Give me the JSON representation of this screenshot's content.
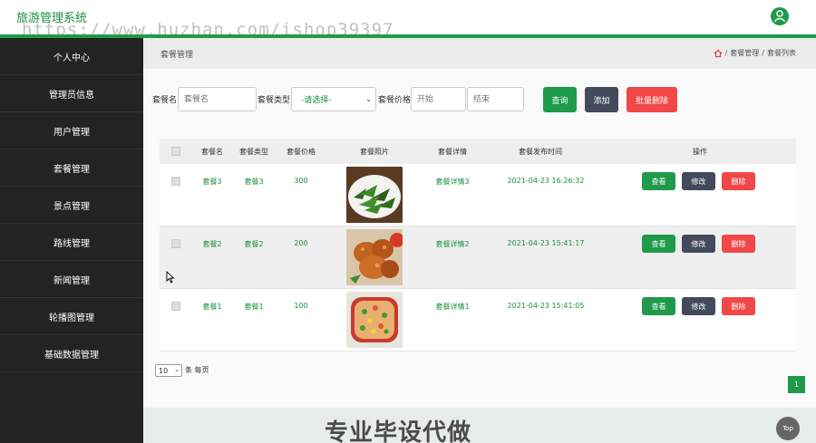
{
  "app": {
    "title": "旅游管理系统",
    "watermark": "https://www.huzhan.com/ishop39397",
    "user_icon": "user-circle-icon"
  },
  "sidebar": {
    "items": [
      {
        "label": "个人中心"
      },
      {
        "label": "管理员信息"
      },
      {
        "label": "用户管理"
      },
      {
        "label": "套餐管理"
      },
      {
        "label": "景点管理"
      },
      {
        "label": "路线管理"
      },
      {
        "label": "新闻管理"
      },
      {
        "label": "轮播图管理"
      },
      {
        "label": "基础数据管理"
      }
    ]
  },
  "header": {
    "page_title": "套餐管理",
    "breadcrumb": [
      "套餐管理",
      "套餐列表"
    ],
    "breadcrumb_sep": "/"
  },
  "search": {
    "name_label": "套餐名",
    "name_placeholder": "套餐名",
    "type_label": "套餐类型",
    "type_selected": "-请选择-",
    "price_label": "套餐价格",
    "price_min_placeholder": "开始",
    "price_max_placeholder": "结束",
    "query_label": "查询",
    "add_label": "添加",
    "batch_delete_label": "批量删除"
  },
  "table": {
    "columns": [
      "套餐名",
      "套餐类型",
      "套餐价格",
      "套餐照片",
      "套餐详情",
      "套餐发布时间",
      "操作"
    ],
    "rows": [
      {
        "name": "套餐3",
        "type": "套餐3",
        "price": "300",
        "photo": "green-vegetable-dish",
        "detail": "套餐详情3",
        "time": "2021-04-23 16:26:32"
      },
      {
        "name": "套餐2",
        "type": "套餐2",
        "price": "200",
        "photo": "fried-chicken-dish",
        "detail": "套餐详情2",
        "time": "2021-04-23 15:41:17"
      },
      {
        "name": "套餐1",
        "type": "套餐1",
        "price": "100",
        "photo": "mixed-vegetable-dish",
        "detail": "套餐详情1",
        "time": "2021-04-23 15:41:05"
      }
    ],
    "actions": {
      "view": "查看",
      "edit": "修改",
      "delete": "删除"
    }
  },
  "pager": {
    "page_size": "10",
    "page_size_suffix": "条 每页",
    "current_page": "1"
  },
  "overlay": {
    "text": "专业毕设代做",
    "top_label": "Top"
  },
  "colors": {
    "accent": "#1e9a4a",
    "dark_button": "#434a5b",
    "danger": "#f04747",
    "sidebar_bg": "#232323"
  }
}
